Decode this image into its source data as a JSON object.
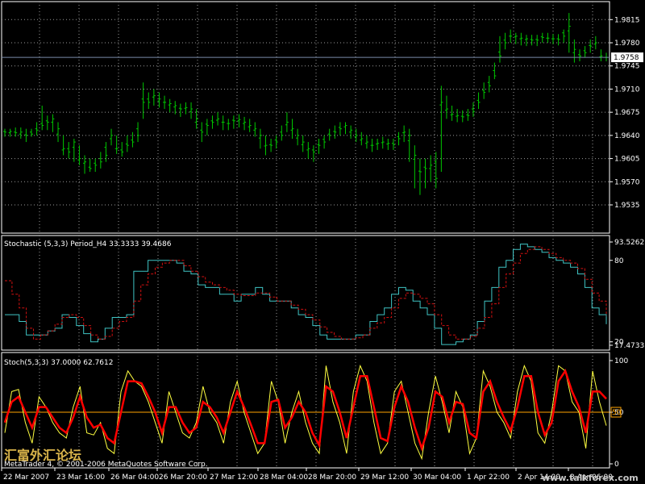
{
  "colors": {
    "background": "#000000",
    "grid": "#9a9a9a",
    "candles": "#00c800",
    "stoch_main": "#3fc4c4",
    "stoch_signal": "#d01010",
    "stoch2_main": "#ffff40",
    "stoch2_signal": "#ff0000",
    "level_line": "#ffa500",
    "price_line": "#7a8aa8",
    "text": "#ffffff"
  },
  "footer": {
    "copyright": "MetaTrader 4, © 2001-2006 MetaQuotes Software Corp.",
    "watermark_cn": "汇富外汇论坛",
    "watermark_url": "www.talkforex.com"
  },
  "chart_data": [
    {
      "type": "ohlc",
      "name": "price",
      "current_price": "1.9758",
      "ylim": [
        1.9535,
        1.983
      ],
      "y_ticks": [
        "1.9815",
        "1.9780",
        "1.9745",
        "1.9710",
        "1.9675",
        "1.9640",
        "1.9605",
        "1.9570",
        "1.9535"
      ],
      "x_ticks": [
        "22 Mar 2007",
        "23 Mar 16:00",
        "26 Mar 04:00",
        "26 Mar 20:00",
        "27 Mar 12:00",
        "28 Mar 04:00",
        "28 Mar 20:00",
        "29 Mar 12:00",
        "30 Mar 04:00",
        "1 Apr 22:00",
        "2 Apr 14:00",
        "3 Apr 06:00"
      ],
      "close": [
        1.9645,
        1.9646,
        1.9644,
        1.9645,
        1.964,
        1.9642,
        1.9648,
        1.9655,
        1.966,
        1.9665,
        1.965,
        1.962,
        1.9615,
        1.963,
        1.9605,
        1.96,
        1.959,
        1.9595,
        1.96,
        1.961,
        1.964,
        1.962,
        1.9615,
        1.9625,
        1.963,
        1.964,
        1.969,
        1.969,
        1.97,
        1.9695,
        1.969,
        1.9688,
        1.9685,
        1.968,
        1.9682,
        1.968,
        1.9665,
        1.9645,
        1.9655,
        1.966,
        1.9665,
        1.966,
        1.9658,
        1.9662,
        1.9664,
        1.966,
        1.9655,
        1.965,
        1.964,
        1.9625,
        1.9625,
        1.963,
        1.964,
        1.966,
        1.965,
        1.964,
        1.963,
        1.962,
        1.9615,
        1.9625,
        1.963,
        1.964,
        1.9645,
        1.965,
        1.9655,
        1.9648,
        1.964,
        1.9635,
        1.963,
        1.9625,
        1.9628,
        1.963,
        1.9628,
        1.9626,
        1.9635,
        1.9645,
        1.964,
        1.961,
        1.9585,
        1.959,
        1.9595,
        1.9575,
        1.969,
        1.968,
        1.9672,
        1.967,
        1.9668,
        1.967,
        1.9676,
        1.969,
        1.9705,
        1.9715,
        1.973,
        1.976,
        1.978,
        1.979,
        1.979,
        1.9787,
        1.9786,
        1.9784,
        1.9784,
        1.9788,
        1.9787,
        1.9786,
        1.9785,
        1.979,
        1.9805,
        1.977,
        1.976,
        1.9765,
        1.9775,
        1.978,
        1.976,
        1.9758
      ],
      "open": [
        1.9646,
        1.9644,
        1.9645,
        1.9642,
        1.9641,
        1.9645,
        1.965,
        1.9658,
        1.9662,
        1.966,
        1.9642,
        1.9618,
        1.962,
        1.9622,
        1.9603,
        1.9598,
        1.9592,
        1.9598,
        1.9605,
        1.9622,
        1.9635,
        1.962,
        1.9618,
        1.9627,
        1.9633,
        1.965,
        1.9695,
        1.9695,
        1.9698,
        1.9692,
        1.969,
        1.9686,
        1.9683,
        1.9681,
        1.9681,
        1.9676,
        1.966,
        1.9648,
        1.9657,
        1.9662,
        1.9663,
        1.966,
        1.9658,
        1.9663,
        1.9662,
        1.9658,
        1.9653,
        1.9648,
        1.9636,
        1.9624,
        1.9626,
        1.9633,
        1.9645,
        1.9656,
        1.9648,
        1.9636,
        1.9626,
        1.9618,
        1.9618,
        1.9626,
        1.9634,
        1.9642,
        1.9646,
        1.9652,
        1.9653,
        1.9645,
        1.9638,
        1.9633,
        1.9628,
        1.9625,
        1.9627,
        1.9629,
        1.9627,
        1.9628,
        1.9638,
        1.9644,
        1.9632,
        1.9604,
        1.9586,
        1.9592,
        1.959,
        1.96,
        1.9686,
        1.9678,
        1.9671,
        1.9669,
        1.9669,
        1.9671,
        1.968,
        1.9693,
        1.9708,
        1.972,
        1.9738,
        1.9766,
        1.9784,
        1.979,
        1.9789,
        1.9786,
        1.9785,
        1.9785,
        1.9785,
        1.9789,
        1.9787,
        1.9786,
        1.9786,
        1.9795,
        1.9798,
        1.9765,
        1.9762,
        1.9768,
        1.9776,
        1.9778,
        1.9759,
        1.9758
      ],
      "high": [
        1.965,
        1.965,
        1.9652,
        1.9652,
        1.965,
        1.965,
        1.966,
        1.9685,
        1.967,
        1.9672,
        1.966,
        1.964,
        1.963,
        1.9635,
        1.9625,
        1.961,
        1.9605,
        1.9605,
        1.9615,
        1.963,
        1.965,
        1.964,
        1.963,
        1.964,
        1.9645,
        1.966,
        1.972,
        1.9705,
        1.971,
        1.9705,
        1.97,
        1.9695,
        1.9692,
        1.9688,
        1.969,
        1.969,
        1.968,
        1.966,
        1.9665,
        1.967,
        1.9675,
        1.967,
        1.9665,
        1.967,
        1.9672,
        1.9668,
        1.9665,
        1.966,
        1.965,
        1.964,
        1.9635,
        1.964,
        1.9655,
        1.9675,
        1.9665,
        1.965,
        1.964,
        1.963,
        1.9625,
        1.9635,
        1.964,
        1.965,
        1.9655,
        1.966,
        1.966,
        1.9655,
        1.965,
        1.9645,
        1.964,
        1.9635,
        1.9635,
        1.9638,
        1.9635,
        1.9635,
        1.9645,
        1.9655,
        1.965,
        1.9625,
        1.9605,
        1.9605,
        1.961,
        1.9615,
        1.9715,
        1.97,
        1.9685,
        1.968,
        1.9678,
        1.968,
        1.969,
        1.9705,
        1.972,
        1.973,
        1.975,
        1.979,
        1.9795,
        1.98,
        1.9795,
        1.9795,
        1.9792,
        1.9792,
        1.9792,
        1.9795,
        1.9795,
        1.9793,
        1.9793,
        1.98,
        1.9825,
        1.9785,
        1.977,
        1.9775,
        1.9785,
        1.979,
        1.977,
        1.9765
      ],
      "low": [
        1.9638,
        1.9638,
        1.9638,
        1.9635,
        1.963,
        1.9638,
        1.964,
        1.9648,
        1.9648,
        1.9645,
        1.963,
        1.961,
        1.9605,
        1.96,
        1.9595,
        1.9582,
        1.9585,
        1.9585,
        1.959,
        1.96,
        1.9625,
        1.9612,
        1.9608,
        1.9615,
        1.9622,
        1.963,
        1.9665,
        1.968,
        1.9685,
        1.9682,
        1.968,
        1.9675,
        1.9672,
        1.9668,
        1.9672,
        1.9665,
        1.965,
        1.963,
        1.964,
        1.965,
        1.9655,
        1.9648,
        1.9648,
        1.965,
        1.9652,
        1.9648,
        1.9645,
        1.9638,
        1.962,
        1.961,
        1.9615,
        1.962,
        1.9632,
        1.9645,
        1.9635,
        1.9625,
        1.9615,
        1.9605,
        1.96,
        1.9612,
        1.962,
        1.9632,
        1.9635,
        1.964,
        1.9642,
        1.9635,
        1.963,
        1.9625,
        1.962,
        1.9615,
        1.9618,
        1.962,
        1.9618,
        1.9618,
        1.9625,
        1.963,
        1.96,
        1.956,
        1.955,
        1.956,
        1.957,
        1.956,
        1.9585,
        1.9665,
        1.9662,
        1.966,
        1.966,
        1.9662,
        1.9668,
        1.968,
        1.9695,
        1.9705,
        1.9725,
        1.975,
        1.977,
        1.978,
        1.9778,
        1.9776,
        1.9775,
        1.9776,
        1.9775,
        1.978,
        1.978,
        1.9778,
        1.9776,
        1.978,
        1.9765,
        1.975,
        1.9752,
        1.9758,
        1.9765,
        1.977,
        1.9752,
        1.9752
      ]
    },
    {
      "type": "line",
      "name": "stochastic_h4",
      "title": "Stochastic (5,3,3) Period_H4 33.3333 39.4686",
      "ylim": [
        17.4733,
        93.5262
      ],
      "y_ticks_labels": [
        "93.5262",
        "80",
        "20",
        "17.4733"
      ],
      "y_ticks_values": [
        93.5262,
        80,
        20,
        17.4733
      ],
      "series": [
        {
          "role": "main",
          "values": [
            40,
            40,
            35,
            25,
            25,
            25,
            28,
            30,
            40,
            38,
            32,
            26,
            20,
            22,
            30,
            38,
            38,
            40,
            72,
            72,
            80,
            80,
            80,
            80,
            78,
            72,
            70,
            62,
            60,
            60,
            55,
            55,
            50,
            55,
            55,
            60,
            55,
            50,
            50,
            50,
            45,
            40,
            38,
            32,
            25,
            22,
            22,
            22,
            22,
            25,
            25,
            35,
            40,
            45,
            55,
            60,
            58,
            50,
            45,
            40,
            30,
            18,
            18,
            20,
            22,
            25,
            35,
            50,
            60,
            75,
            80,
            88,
            92,
            90,
            88,
            86,
            82,
            80,
            78,
            75,
            70,
            60,
            45,
            40,
            33
          ]
        },
        {
          "role": "signal",
          "values": [
            65,
            55,
            45,
            30,
            22,
            25,
            28,
            33,
            38,
            40,
            38,
            32,
            25,
            22,
            24,
            30,
            35,
            38,
            50,
            62,
            70,
            75,
            78,
            80,
            80,
            76,
            72,
            68,
            64,
            62,
            60,
            58,
            55,
            54,
            54,
            56,
            56,
            53,
            50,
            50,
            47,
            44,
            40,
            36,
            31,
            27,
            24,
            22,
            22,
            23,
            25,
            30,
            34,
            38,
            45,
            52,
            56,
            55,
            52,
            48,
            40,
            32,
            25,
            22,
            22,
            24,
            30,
            38,
            48,
            60,
            70,
            78,
            85,
            88,
            90,
            88,
            85,
            82,
            80,
            78,
            74,
            66,
            56,
            50,
            39
          ]
        }
      ]
    },
    {
      "type": "line",
      "name": "stochastic",
      "title": "Stoch(5,3,3) 37.0000 62.7612",
      "ylim": [
        0,
        100
      ],
      "y_ticks_labels": [
        "100",
        "50",
        "0"
      ],
      "y_ticks_values": [
        100,
        50,
        0
      ],
      "level": 50,
      "level_label": "50",
      "series": [
        {
          "role": "main",
          "values": [
            30,
            70,
            72,
            40,
            20,
            65,
            55,
            40,
            30,
            25,
            55,
            75,
            30,
            28,
            40,
            15,
            10,
            70,
            90,
            80,
            75,
            60,
            40,
            20,
            70,
            50,
            30,
            25,
            40,
            75,
            50,
            40,
            20,
            60,
            80,
            50,
            30,
            10,
            20,
            80,
            60,
            20,
            50,
            70,
            40,
            20,
            10,
            95,
            60,
            40,
            10,
            70,
            95,
            80,
            40,
            10,
            20,
            70,
            80,
            50,
            20,
            5,
            50,
            85,
            60,
            30,
            70,
            55,
            10,
            25,
            90,
            75,
            50,
            40,
            25,
            70,
            95,
            80,
            30,
            20,
            50,
            95,
            90,
            60,
            50,
            15,
            90,
            60,
            37
          ]
        },
        {
          "role": "signal",
          "values": [
            40,
            60,
            65,
            50,
            35,
            55,
            55,
            45,
            35,
            30,
            45,
            65,
            45,
            35,
            38,
            25,
            20,
            50,
            80,
            80,
            78,
            65,
            50,
            30,
            55,
            55,
            40,
            30,
            35,
            60,
            55,
            45,
            30,
            50,
            70,
            55,
            38,
            20,
            20,
            60,
            62,
            35,
            45,
            60,
            50,
            30,
            18,
            75,
            70,
            50,
            25,
            55,
            85,
            85,
            55,
            25,
            22,
            55,
            75,
            60,
            35,
            15,
            35,
            70,
            65,
            40,
            60,
            58,
            30,
            25,
            70,
            80,
            60,
            45,
            32,
            55,
            85,
            85,
            50,
            28,
            40,
            80,
            90,
            70,
            55,
            30,
            70,
            70,
            63
          ]
        }
      ]
    }
  ]
}
